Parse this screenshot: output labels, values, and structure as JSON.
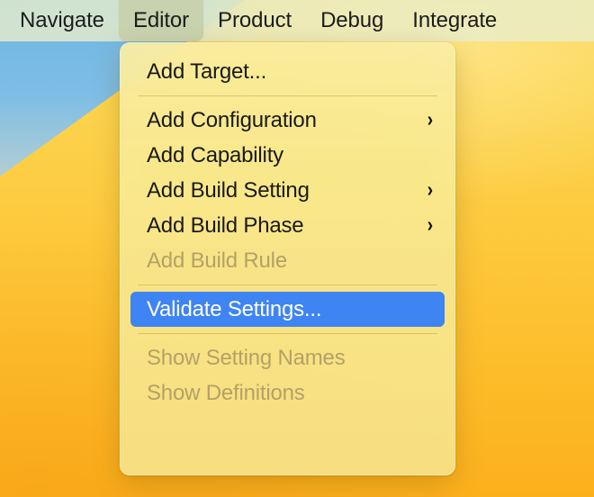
{
  "menubar": {
    "items": [
      {
        "label": "Navigate",
        "active": false
      },
      {
        "label": "Editor",
        "active": true
      },
      {
        "label": "Product",
        "active": false
      },
      {
        "label": "Debug",
        "active": false
      },
      {
        "label": "Integrate",
        "active": false
      }
    ]
  },
  "menu": {
    "owner": "Editor",
    "items": [
      {
        "type": "item",
        "label": "Add Target...",
        "submenu": false,
        "disabled": false,
        "selected": false
      },
      {
        "type": "separator"
      },
      {
        "type": "item",
        "label": "Add Configuration",
        "submenu": true,
        "disabled": false,
        "selected": false,
        "chevron": "›"
      },
      {
        "type": "item",
        "label": "Add Capability",
        "submenu": false,
        "disabled": false,
        "selected": false
      },
      {
        "type": "item",
        "label": "Add Build Setting",
        "submenu": true,
        "disabled": false,
        "selected": false,
        "chevron": "›"
      },
      {
        "type": "item",
        "label": "Add Build Phase",
        "submenu": true,
        "disabled": false,
        "selected": false,
        "chevron": "›"
      },
      {
        "type": "item",
        "label": "Add Build Rule",
        "submenu": false,
        "disabled": true,
        "selected": false
      },
      {
        "type": "separator"
      },
      {
        "type": "item",
        "label": "Validate Settings...",
        "submenu": false,
        "disabled": false,
        "selected": true
      },
      {
        "type": "separator"
      },
      {
        "type": "item",
        "label": "Show Setting Names",
        "submenu": false,
        "disabled": true,
        "selected": false
      },
      {
        "type": "item",
        "label": "Show Definitions",
        "submenu": false,
        "disabled": true,
        "selected": false
      }
    ]
  },
  "colors": {
    "menubar_bg": "#e9eecb",
    "menubar_active_bg": "#c8d2ae",
    "panel_bg": "#f9ea96",
    "selection_blue": "#3f84f3",
    "text": "#1a1a1a",
    "disabled_text": "#b3a265",
    "separator": "#8c7828",
    "wallpaper_sky": "#6fb6e2",
    "wallpaper_dune_top": "#fbd85b",
    "wallpaper_dune_bottom": "#fcb01c"
  }
}
